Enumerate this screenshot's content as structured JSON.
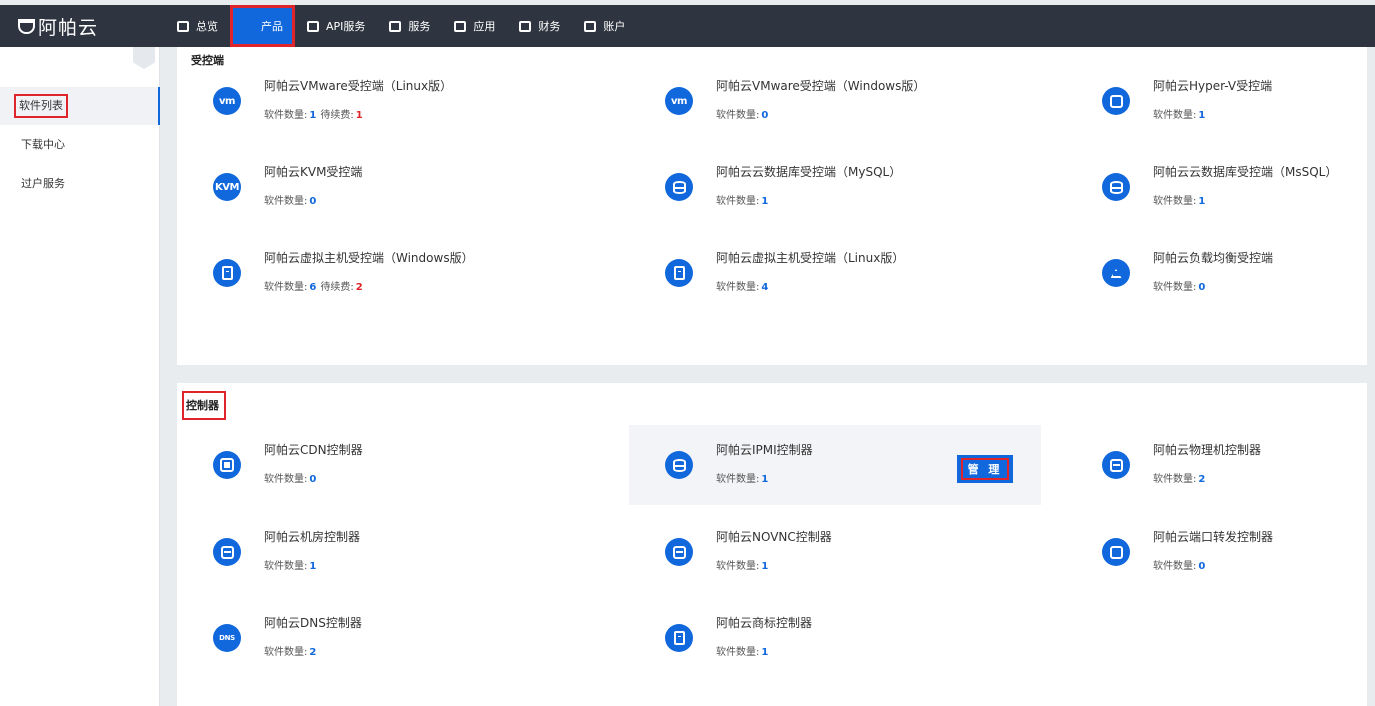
{
  "app": {
    "logo": "阿帕云"
  },
  "nav": [
    {
      "label": "总览",
      "icon": "dashboard-icon",
      "active": false
    },
    {
      "label": "产品",
      "icon": "grid-icon",
      "active": true
    },
    {
      "label": "API服务",
      "icon": "api-icon",
      "active": false
    },
    {
      "label": "服务",
      "icon": "service-icon",
      "active": false
    },
    {
      "label": "应用",
      "icon": "app-icon",
      "active": false
    },
    {
      "label": "财务",
      "icon": "finance-icon",
      "active": false
    },
    {
      "label": "账户",
      "icon": "account-icon",
      "active": false
    }
  ],
  "sidebar": {
    "items": [
      {
        "label": "软件列表",
        "active": true
      },
      {
        "label": "下载中心",
        "active": false
      },
      {
        "label": "过户服务",
        "active": false
      }
    ]
  },
  "labels": {
    "count": "软件数量:",
    "renewal": "待续费:",
    "manage": "管 理"
  },
  "sections": [
    {
      "title": "受控端",
      "items": [
        {
          "name": "阿帕云VMware受控端（Linux版）",
          "count": "1",
          "renewal": "1",
          "icon": "vm-icon",
          "glyph": "vm"
        },
        {
          "name": "阿帕云VMware受控端（Windows版）",
          "count": "0",
          "icon": "vm-icon",
          "glyph": "vm"
        },
        {
          "name": "阿帕云Hyper-V受控端",
          "count": "1",
          "icon": "hyperv-icon"
        },
        {
          "name": "阿帕云KVM受控端",
          "count": "0",
          "icon": "kvm-icon",
          "glyph": "KVM"
        },
        {
          "name": "阿帕云云数据库受控端（MySQL）",
          "count": "1",
          "icon": "database-icon"
        },
        {
          "name": "阿帕云云数据库受控端（MsSQL）",
          "count": "1",
          "icon": "database-icon"
        },
        {
          "name": "阿帕云虚拟主机受控端（Windows版）",
          "count": "6",
          "renewal": "2",
          "icon": "vhost-icon"
        },
        {
          "name": "阿帕云虚拟主机受控端（Linux版）",
          "count": "4",
          "icon": "vhost-icon"
        },
        {
          "name": "阿帕云负载均衡受控端",
          "count": "0",
          "icon": "load-balancer-icon"
        }
      ]
    },
    {
      "title": "控制器",
      "items": [
        {
          "name": "阿帕云CDN控制器",
          "count": "0",
          "icon": "cdn-icon"
        },
        {
          "name": "阿帕云IPMI控制器",
          "count": "1",
          "icon": "ipmi-icon",
          "hover": true
        },
        {
          "name": "阿帕云物理机控制器",
          "count": "2",
          "icon": "server-icon"
        },
        {
          "name": "阿帕云机房控制器",
          "count": "1",
          "icon": "datacenter-icon"
        },
        {
          "name": "阿帕云NOVNC控制器",
          "count": "1",
          "icon": "novnc-icon"
        },
        {
          "name": "阿帕云端口转发控制器",
          "count": "0",
          "icon": "port-forward-icon"
        },
        {
          "name": "阿帕云DNS控制器",
          "count": "2",
          "icon": "dns-icon",
          "glyph": "DNS"
        },
        {
          "name": "阿帕云商标控制器",
          "count": "1",
          "icon": "trademark-icon"
        }
      ]
    }
  ],
  "colors": {
    "accent": "#1168dc",
    "topbar": "#2f3540",
    "highlight": "#e0242b",
    "warning": "#e0242b"
  }
}
